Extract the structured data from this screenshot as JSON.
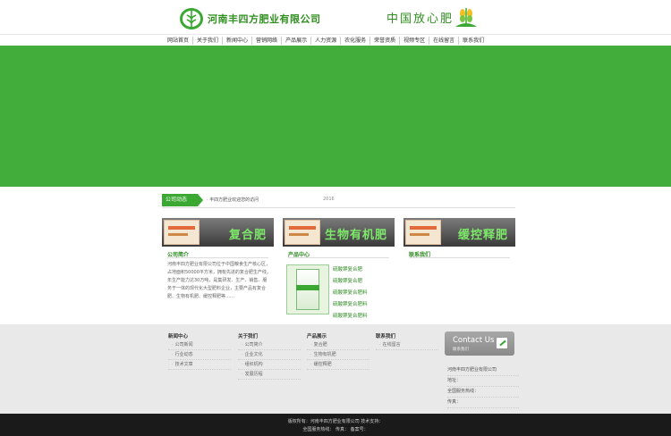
{
  "header": {
    "company_name": "河南丰四方肥业有限公司",
    "slogan": "中国放心肥",
    "colors": {
      "brand_green": "#2f8f1f",
      "banner_green": "#43ad3b"
    }
  },
  "nav": {
    "items": [
      "网站首页",
      "关于我们",
      "新闻中心",
      "营销网络",
      "产品展示",
      "人力资源",
      "农化服务",
      "荣誉资质",
      "视频专区",
      "在线留言",
      "联系我们"
    ]
  },
  "news": {
    "tab_label": "公司动态",
    "headline": "· 丰四方肥业欢迎您的访问",
    "date": "2016"
  },
  "boxes": [
    {
      "title": "复合肥",
      "subtitle": "公司简介",
      "body": "河南丰四方肥业有限公司位于中国粮食生产核心区，占地面积50000平方米，拥有先进的复合肥生产线，年生产能力达30万吨，是集研发、生产、销售、服务于一体的现代化大型肥料企业，主要产品有复合肥、生物有机肥、缓控释肥等……"
    },
    {
      "title": "生物有机肥",
      "subtitle": "产品中心",
      "products": [
        "硫酸钾复合肥",
        "硫酸钾复合肥",
        "硫酸钾复合肥料",
        "硫酸钾复合肥料",
        "硫酸钾复合肥料"
      ]
    },
    {
      "title": "缓控释肥",
      "subtitle": "联系我们"
    }
  ],
  "footer": {
    "columns": [
      {
        "title": "新闻中心",
        "links": [
          "公司新闻",
          "行业动态",
          "技术文章"
        ]
      },
      {
        "title": "关于我们",
        "links": [
          "公司简介",
          "企业文化",
          "组织机构",
          "发展历程"
        ]
      },
      {
        "title": "产品展示",
        "links": [
          "复合肥",
          "生物有机肥",
          "缓控释肥"
        ]
      },
      {
        "title": "联系我们",
        "links": [
          "在线留言"
        ]
      }
    ],
    "contact_button": {
      "title": "Contact Us",
      "subtitle": "联系我们"
    },
    "contact_lines": [
      "河南丰四方肥业有限公司",
      "地址：",
      "全国服务热线：",
      "传真："
    ]
  },
  "bottom": {
    "line1": "版权所有：河南丰四方肥业有限公司    技术支持：",
    "line2": "全国服务热线：    传真：    备案号："
  }
}
